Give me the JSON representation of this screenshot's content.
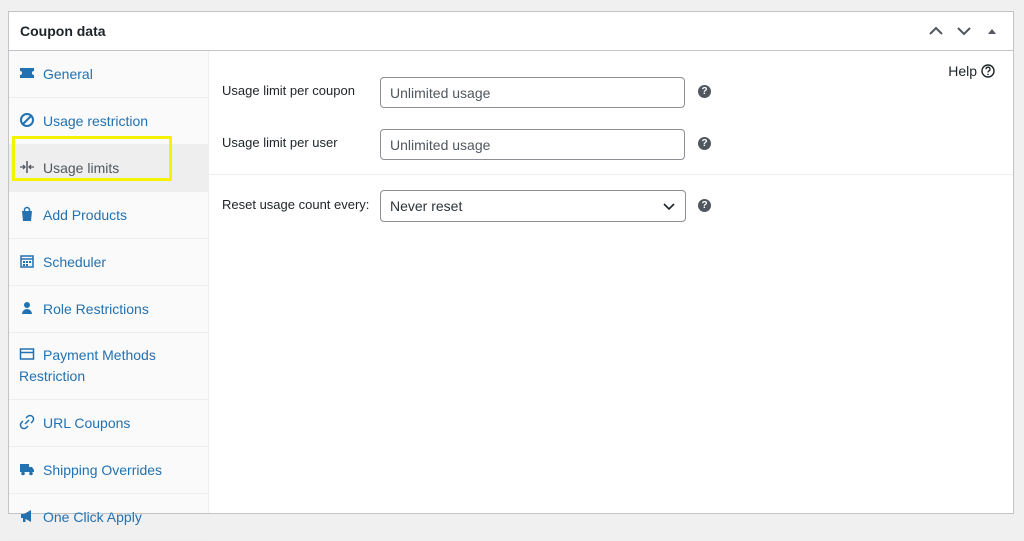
{
  "header": {
    "title": "Coupon data"
  },
  "tabs": [
    {
      "key": "general",
      "label": "General",
      "icon": "ticket-icon"
    },
    {
      "key": "usage-restriction",
      "label": "Usage restriction",
      "icon": "block-icon"
    },
    {
      "key": "usage-limits",
      "label": "Usage limits",
      "icon": "limit-icon"
    },
    {
      "key": "add-products",
      "label": "Add Products",
      "icon": "bag-icon"
    },
    {
      "key": "scheduler",
      "label": "Scheduler",
      "icon": "calendar-icon"
    },
    {
      "key": "role-restrictions",
      "label": "Role Restrictions",
      "icon": "user-icon"
    },
    {
      "key": "payment-methods",
      "label": "Payment Methods Restriction",
      "icon": "card-icon"
    },
    {
      "key": "url-coupons",
      "label": "URL Coupons",
      "icon": "link-icon"
    },
    {
      "key": "shipping-overrides",
      "label": "Shipping Overrides",
      "icon": "truck-icon"
    },
    {
      "key": "one-click-apply",
      "label": "One Click Apply",
      "icon": "megaphone-icon"
    }
  ],
  "active_tab": "Usage limits",
  "panel": {
    "help_label": "Help",
    "usage_limit_per_coupon": {
      "label": "Usage limit per coupon",
      "value": "",
      "placeholder": "Unlimited usage"
    },
    "usage_limit_per_user": {
      "label": "Usage limit per user",
      "value": "",
      "placeholder": "Unlimited usage"
    },
    "reset_usage": {
      "label": "Reset usage count every:",
      "selected": "Never reset"
    }
  },
  "colors": {
    "link": "#2271b1",
    "highlight": "#f5f200",
    "border": "#c3c4c7"
  }
}
